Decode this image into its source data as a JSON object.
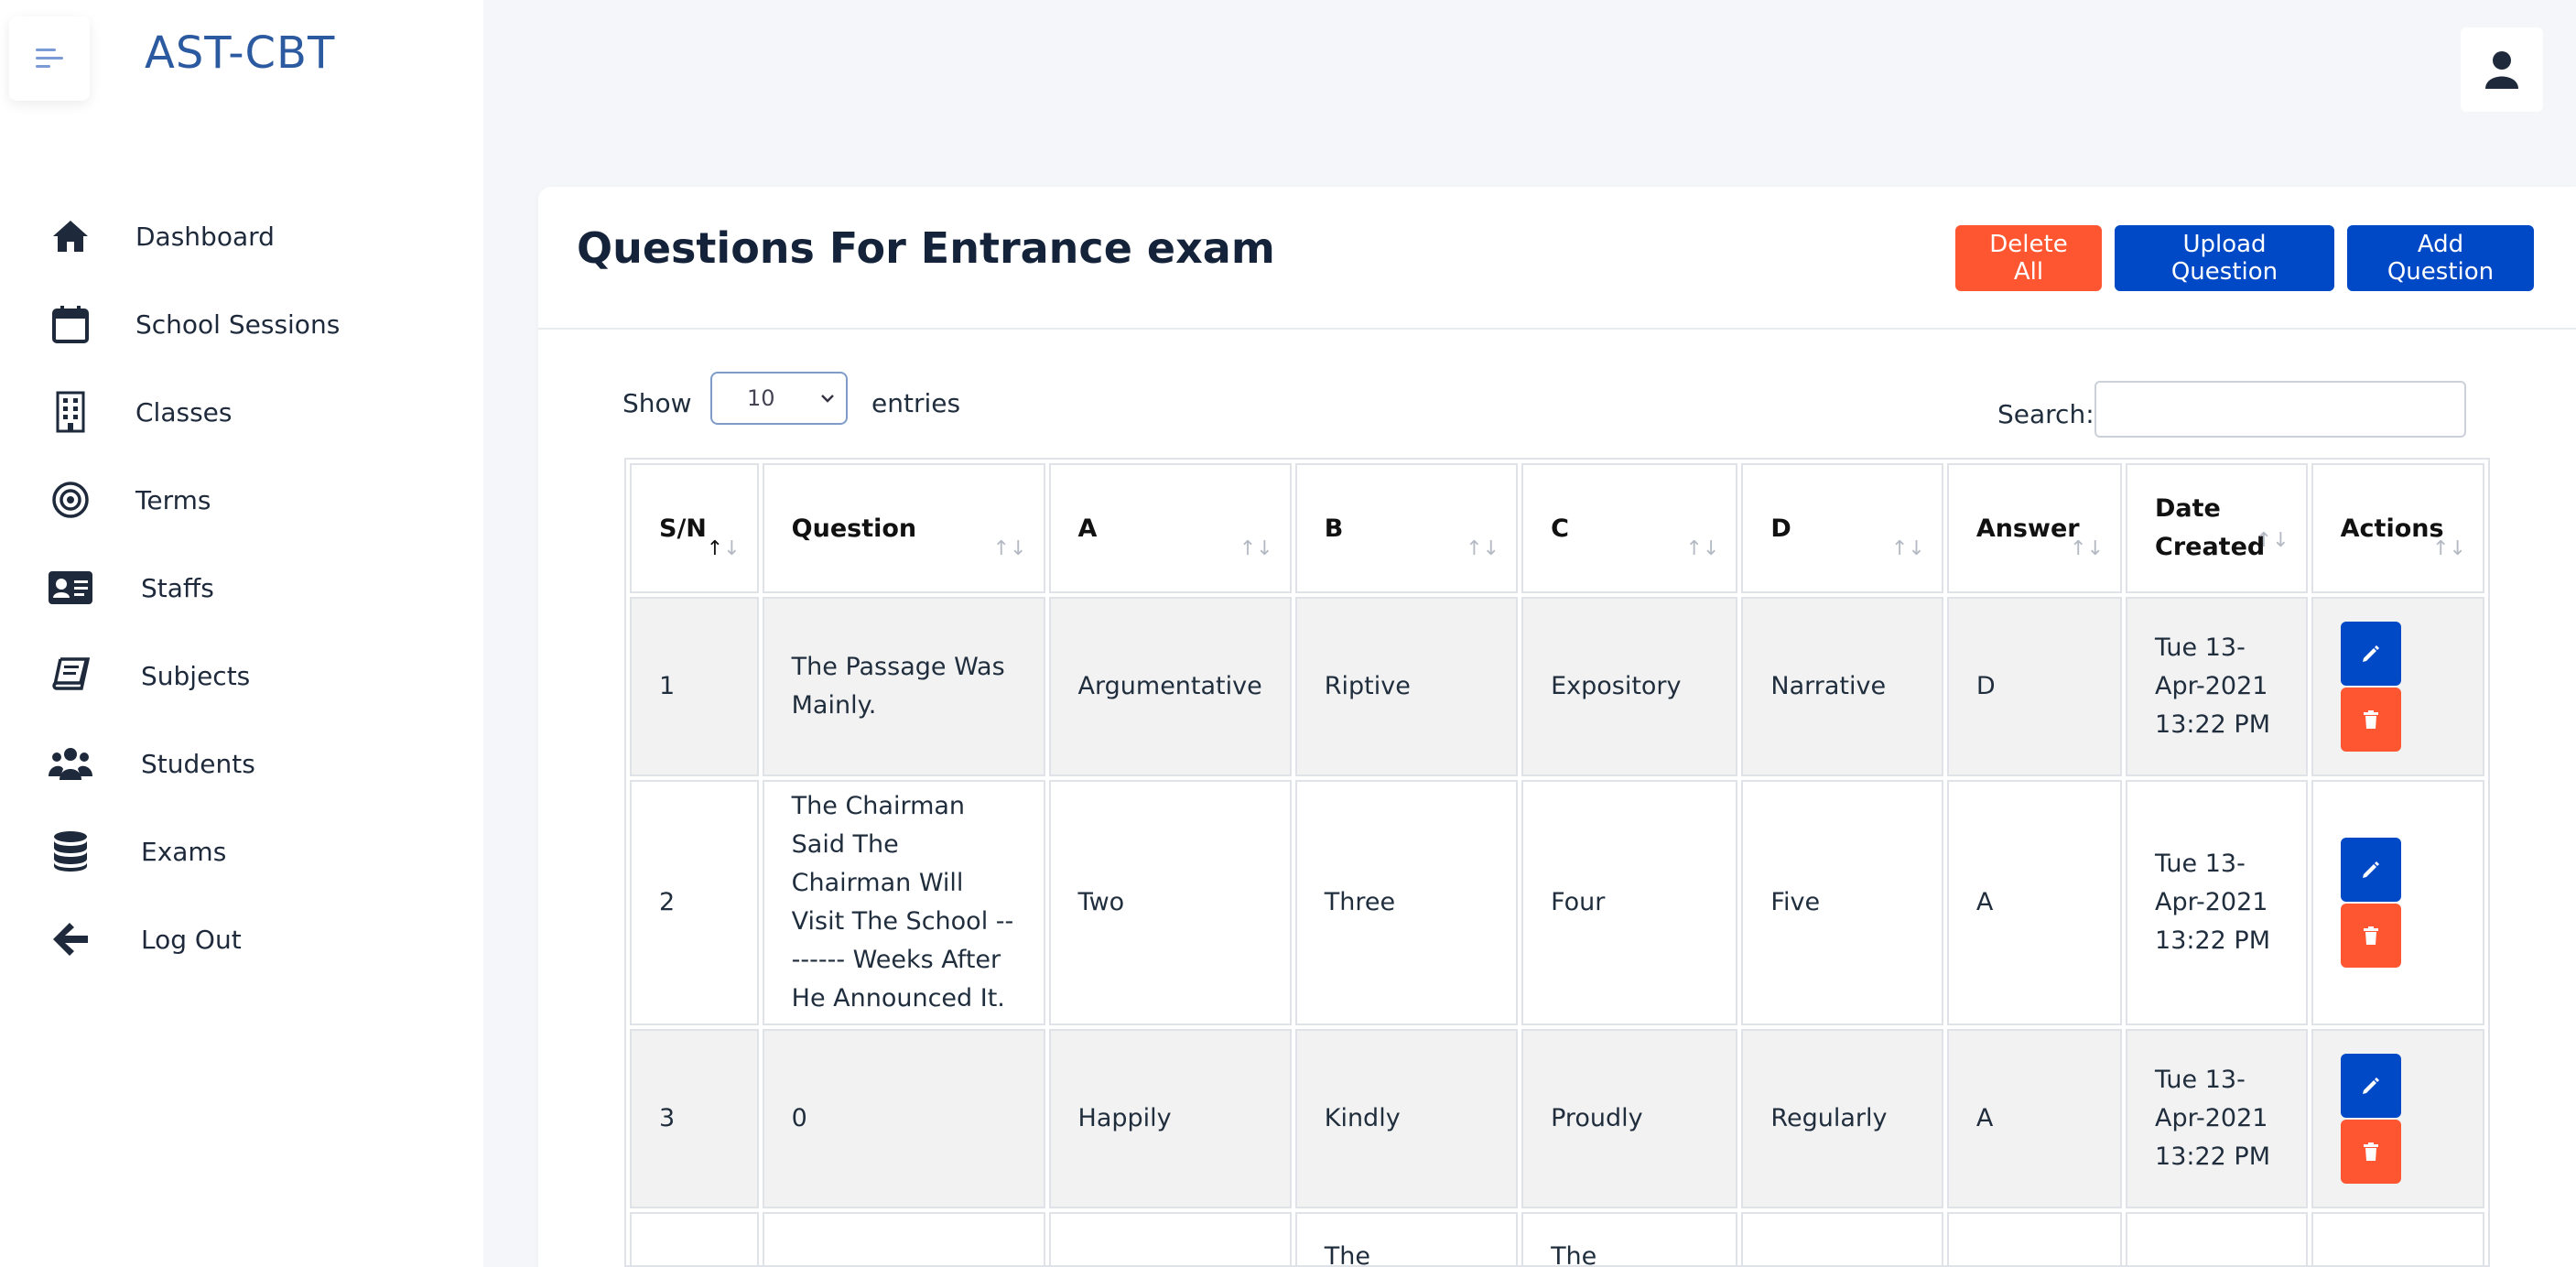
{
  "brand": "AST-CBT",
  "sidebar": {
    "items": [
      {
        "label": "Dashboard",
        "icon": "home-icon"
      },
      {
        "label": "School Sessions",
        "icon": "calendar-icon"
      },
      {
        "label": "Classes",
        "icon": "building-icon"
      },
      {
        "label": "Terms",
        "icon": "target-icon"
      },
      {
        "label": "Staffs",
        "icon": "id-card-icon"
      },
      {
        "label": "Subjects",
        "icon": "book-icon"
      },
      {
        "label": "Students",
        "icon": "users-icon"
      },
      {
        "label": "Exams",
        "icon": "database-icon"
      },
      {
        "label": "Log Out",
        "icon": "arrow-left-icon"
      }
    ]
  },
  "page": {
    "title": "Questions For Entrance exam",
    "buttons": {
      "delete_all": "Delete All",
      "upload": "Upload Question",
      "add": "Add Question"
    }
  },
  "controls": {
    "show_label": "Show",
    "entries_value": "10",
    "entries_label": "entries",
    "search_label": "Search:",
    "search_value": ""
  },
  "table": {
    "headers": [
      "S/N",
      "Question",
      "A",
      "B",
      "C",
      "D",
      "Answer",
      "Date Created",
      "Actions"
    ],
    "rows": [
      {
        "sn": "1",
        "question": "The Passage Was Mainly.",
        "a": "Argumentative",
        "b": "Riptive",
        "c": "Expository",
        "d": "Narrative",
        "answer": "D",
        "date": "Tue 13-Apr-2021 13:22 PM"
      },
      {
        "sn": "2",
        "question": "The Chairman Said The Chairman Will Visit The School -------- Weeks After He Announced It.",
        "a": "Two",
        "b": "Three",
        "c": "Four",
        "d": "Five",
        "answer": "A",
        "date": "Tue 13-Apr-2021 13:22 PM"
      },
      {
        "sn": "3",
        "question": "0",
        "a": "Happily",
        "b": "Kindly",
        "c": "Proudly",
        "d": "Regularly",
        "answer": "A",
        "date": "Tue 13-Apr-2021 13:22 PM"
      },
      {
        "sn": "",
        "question": "",
        "a": "",
        "b": "The Chairman",
        "c": "The",
        "d": "",
        "answer": "",
        "date": ""
      }
    ]
  },
  "colors": {
    "accent_blue": "#0049c6",
    "accent_red": "#fd5630",
    "brand": "#2c5aa0"
  }
}
